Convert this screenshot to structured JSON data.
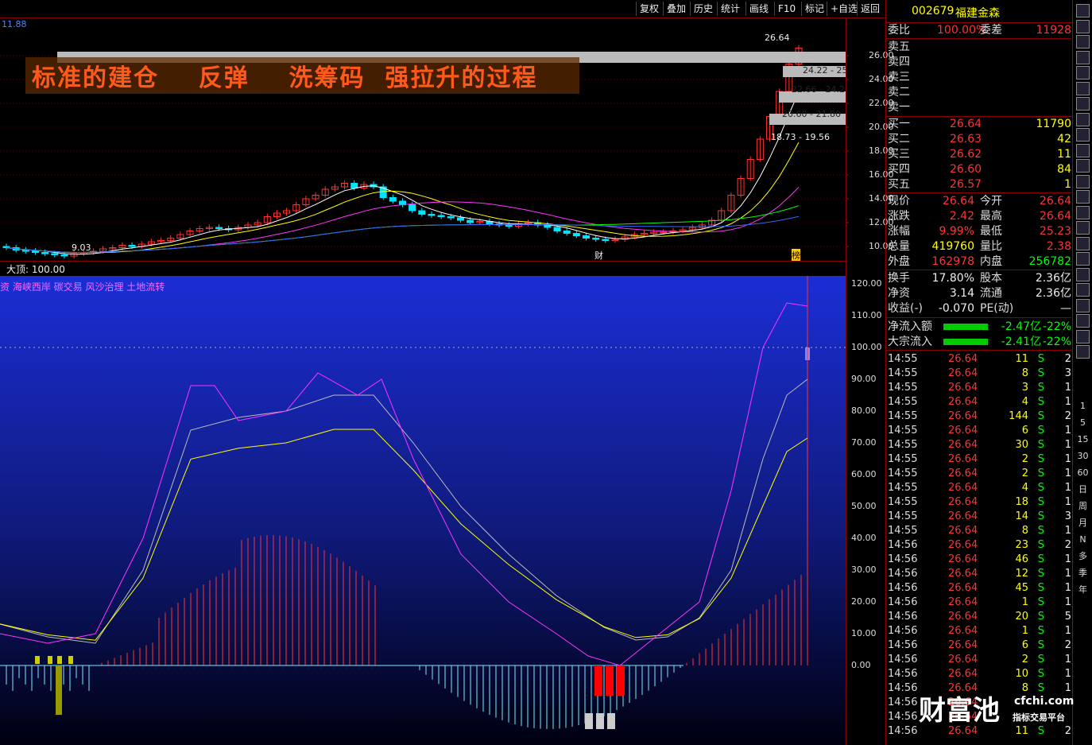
{
  "toolbar": {
    "buttons": [
      "复权",
      "叠加",
      "历史",
      "统计",
      "画线",
      "F10",
      "标记",
      "+自选",
      "返回"
    ]
  },
  "kchart": {
    "top_left_value": "11.88",
    "title": "标准的建仓    反弹    洗筹码  强拉升的过程",
    "price_axis": [
      "26.00",
      "24.00",
      "22.00",
      "20.00",
      "18.00",
      "16.00",
      "14.00",
      "12.00",
      "10.00"
    ],
    "high_label": "26.64",
    "low_label": "9.03",
    "chip_labels": [
      "24.22 - 25",
      "22.66 - 24.2",
      "20.60 - 21.80",
      "18.73 - 19.56"
    ],
    "markers": [
      "财",
      "榜"
    ]
  },
  "indicator": {
    "header": "大顶: 100.00",
    "concepts": "资 海峡西岸 碳交易 风沙治理 土地流转",
    "axis": [
      "120.00",
      "110.00",
      "100.00",
      "90.00",
      "80.00",
      "70.00",
      "60.00",
      "50.00",
      "40.00",
      "30.00",
      "20.00",
      "10.00",
      "0.00"
    ]
  },
  "quote": {
    "code": "002679",
    "name": "福建金森",
    "weibi_label": "委比",
    "weibi": "100.00%",
    "weicha_label": "委差",
    "weicha": "11928",
    "sell": [
      {
        "label": "卖五"
      },
      {
        "label": "卖四"
      },
      {
        "label": "卖三"
      },
      {
        "label": "卖二"
      },
      {
        "label": "卖一"
      }
    ],
    "buy": [
      {
        "label": "买一",
        "price": "26.64",
        "vol": "11790"
      },
      {
        "label": "买二",
        "price": "26.63",
        "vol": "42"
      },
      {
        "label": "买三",
        "price": "26.62",
        "vol": "11"
      },
      {
        "label": "买四",
        "price": "26.60",
        "vol": "84"
      },
      {
        "label": "买五",
        "price": "26.57",
        "vol": "1"
      }
    ],
    "stats": [
      {
        "l1": "现价",
        "v1": "26.64",
        "c1": "red",
        "l2": "今开",
        "v2": "26.64",
        "c2": "red"
      },
      {
        "l1": "涨跌",
        "v1": "2.42",
        "c1": "red",
        "l2": "最高",
        "v2": "26.64",
        "c2": "red"
      },
      {
        "l1": "涨幅",
        "v1": "9.99%",
        "c1": "red",
        "l2": "最低",
        "v2": "25.23",
        "c2": "red"
      },
      {
        "l1": "总量",
        "v1": "419760",
        "c1": "yel",
        "l2": "量比",
        "v2": "2.38",
        "c2": "red"
      },
      {
        "l1": "外盘",
        "v1": "162978",
        "c1": "red",
        "l2": "内盘",
        "v2": "256782",
        "c2": "grn"
      }
    ],
    "stats2": [
      {
        "l1": "换手",
        "v1": "17.80%",
        "l2": "股本",
        "v2": "2.36亿"
      },
      {
        "l1": "净资",
        "v1": "3.14",
        "l2": "流通",
        "v2": "2.36亿"
      },
      {
        "l1": "收益(-)",
        "v1": "-0.070",
        "l2": "PE(动)",
        "v2": "—"
      }
    ],
    "flows": [
      {
        "label": "净流入额",
        "value": "-2.47亿",
        "pct": "-22%"
      },
      {
        "label": "大宗流入",
        "value": "-2.41亿",
        "pct": "-22%"
      }
    ],
    "ticks": [
      {
        "t": "14:55",
        "p": "26.64",
        "v": "11",
        "s": "S",
        "n": "2"
      },
      {
        "t": "14:55",
        "p": "26.64",
        "v": "8",
        "s": "S",
        "n": "3"
      },
      {
        "t": "14:55",
        "p": "26.64",
        "v": "3",
        "s": "S",
        "n": "1"
      },
      {
        "t": "14:55",
        "p": "26.64",
        "v": "4",
        "s": "S",
        "n": "1"
      },
      {
        "t": "14:55",
        "p": "26.64",
        "v": "144",
        "s": "S",
        "n": "2"
      },
      {
        "t": "14:55",
        "p": "26.64",
        "v": "6",
        "s": "S",
        "n": "1"
      },
      {
        "t": "14:55",
        "p": "26.64",
        "v": "30",
        "s": "S",
        "n": "1"
      },
      {
        "t": "14:55",
        "p": "26.64",
        "v": "2",
        "s": "S",
        "n": "1"
      },
      {
        "t": "14:55",
        "p": "26.64",
        "v": "2",
        "s": "S",
        "n": "1"
      },
      {
        "t": "14:55",
        "p": "26.64",
        "v": "4",
        "s": "S",
        "n": "1"
      },
      {
        "t": "14:55",
        "p": "26.64",
        "v": "18",
        "s": "S",
        "n": "1"
      },
      {
        "t": "14:55",
        "p": "26.64",
        "v": "14",
        "s": "S",
        "n": "3"
      },
      {
        "t": "14:55",
        "p": "26.64",
        "v": "8",
        "s": "S",
        "n": "1"
      },
      {
        "t": "14:56",
        "p": "26.64",
        "v": "23",
        "s": "S",
        "n": "2"
      },
      {
        "t": "14:56",
        "p": "26.64",
        "v": "46",
        "s": "S",
        "n": "1"
      },
      {
        "t": "14:56",
        "p": "26.64",
        "v": "12",
        "s": "S",
        "n": "1"
      },
      {
        "t": "14:56",
        "p": "26.64",
        "v": "45",
        "s": "S",
        "n": "1"
      },
      {
        "t": "14:56",
        "p": "26.64",
        "v": "1",
        "s": "S",
        "n": "1"
      },
      {
        "t": "14:56",
        "p": "26.64",
        "v": "20",
        "s": "S",
        "n": "5"
      },
      {
        "t": "14:56",
        "p": "26.64",
        "v": "1",
        "s": "S",
        "n": "1"
      },
      {
        "t": "14:56",
        "p": "26.64",
        "v": "6",
        "s": "S",
        "n": "2"
      },
      {
        "t": "14:56",
        "p": "26.64",
        "v": "2",
        "s": "S",
        "n": "1"
      },
      {
        "t": "14:56",
        "p": "26.64",
        "v": "10",
        "s": "S",
        "n": "1"
      },
      {
        "t": "14:56",
        "p": "26.64",
        "v": "8",
        "s": "S",
        "n": "1"
      },
      {
        "t": "14:56",
        "p": "26.64",
        "v": "",
        "s": "",
        "n": ""
      },
      {
        "t": "14:56",
        "p": "26.64",
        "v": "",
        "s": "",
        "n": ""
      },
      {
        "t": "14:56",
        "p": "26.64",
        "v": "11",
        "s": "S",
        "n": "2"
      }
    ]
  },
  "sidebar": {
    "periods": [
      "1",
      "5",
      "15",
      "30",
      "60",
      "日",
      "周",
      "月",
      "N",
      "多",
      "季",
      "年"
    ]
  },
  "watermark": {
    "brand": "财富池",
    "site": "cfchi.com",
    "sub": "指标交易平台"
  }
}
